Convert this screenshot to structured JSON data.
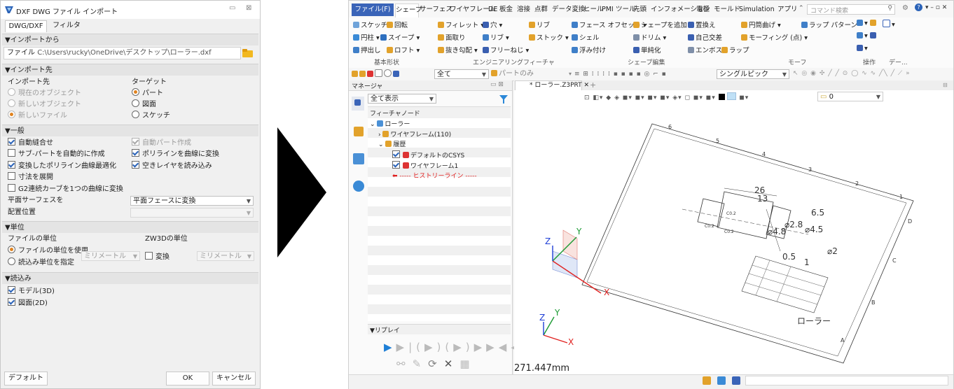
{
  "dialog": {
    "title": "DXF DWG ファイル インポート",
    "tabs": [
      "DWG/DXF",
      "フィルタ"
    ],
    "import_from": {
      "header": "▼インポートから",
      "file_label": "ファイル",
      "file_value": "C:\\Users\\rucky\\OneDrive\\デスクトップ\\ローラー.dxf"
    },
    "import_to": {
      "header": "▼インポート先",
      "dest_label": "インポート先",
      "dest_options": [
        "現在のオブジェクト",
        "新しいオブジェクト",
        "新しいファイル"
      ],
      "target_label": "ターゲット",
      "target_options": [
        "パート",
        "図面",
        "スケッチ"
      ]
    },
    "general": {
      "header": "▼一般",
      "left": [
        "自動縫合せ",
        "サブ-パートを自動的に作成",
        "変換したポリライン曲線最適化",
        "寸法を展開",
        "G2連続カーブを1つの曲線に変換"
      ],
      "right": [
        "自動パート作成",
        "ポリラインを曲線に変換",
        "空きレイヤを読み込み"
      ],
      "plane_face_label": "平面サーフェスを",
      "plane_face_value": "平面フェースに変換",
      "placement_label": "配置位置"
    },
    "units": {
      "header": "▼単位",
      "file_units_label": "ファイルの単位",
      "use_file_units": "ファイルの単位を使用",
      "specify_units": "読込み単位を指定",
      "unit_value": "ミリメートル",
      "zw3d_units_label": "ZW3Dの単位",
      "convert_label": "変換",
      "zw3d_unit_value": "ミリメートル"
    },
    "read": {
      "header": "▼読込み",
      "items": [
        "モデル(3D)",
        "図面(2D)"
      ]
    },
    "buttons": {
      "default": "デフォルト",
      "ok": "OK",
      "cancel": "キャンセル"
    }
  },
  "app": {
    "menu": [
      "ファイル(F)",
      "シェープ",
      "サーフェス",
      "ワイヤフレーム",
      "DE",
      "板金",
      "溶接",
      "点群",
      "データ変換",
      "ヒール",
      "PMI",
      "ツール",
      "先頭",
      "インフォメーション",
      "電極",
      "モールド",
      "Simulation",
      "アプリ"
    ],
    "command_search_placeholder": "コマンド検索",
    "ribbon": {
      "basic_shape": {
        "label": "基本形状",
        "items": [
          "スケッチ",
          "回転",
          "円柱",
          "スイープ",
          "押出し",
          "ロフト"
        ]
      },
      "engineering": {
        "label": "エンジニアリングフィーチャ",
        "items": [
          "フィレット",
          "穴",
          "リブ",
          "面取り",
          "リブ",
          "ストック",
          "抜き勾配",
          "フリーねじ"
        ]
      },
      "shape_edit": {
        "label": "シェープ編集",
        "items": [
          "フェース オフセット",
          "シェープを追加",
          "置換え",
          "シェル",
          "ドリム",
          "自己交差",
          "浮み付け",
          "単純化",
          "エンボス",
          "ラップ"
        ]
      },
      "morph": {
        "label": "モーフ",
        "items": [
          "円筒曲げ",
          "ラップ パターン",
          "モーフィング (点)"
        ]
      },
      "ops": {
        "label": "操作"
      },
      "data": {
        "label": "デー..."
      }
    },
    "toolbar": {
      "filter_all": "全て",
      "part_only": "パートのみ",
      "pick_mode": "シングルピック"
    },
    "manager": {
      "title": "マネージャ",
      "show_all": "全て表示",
      "feature_node_header": "フィーチャノード",
      "tree": [
        "ローラー",
        "ワイヤフレーム(110)",
        "履歴",
        "デフォルトのCSYS",
        "ワイヤフレーム1",
        "----- ヒストリーライン -----"
      ]
    },
    "replay": {
      "header": "▼リプレイ"
    },
    "doc_tab": "* ローラー.Z3PRT",
    "view_field_value": "0",
    "measure": "271.447mm",
    "drawing": {
      "dims": [
        "26",
        "13",
        "⌀4.8",
        "6.5",
        "⌀2.8",
        "⌀4.5",
        "0.5",
        "1",
        "⌀2"
      ],
      "title_block_name": "ローラー",
      "frame_numbers": [
        "6",
        "5",
        "4",
        "3",
        "2",
        "1"
      ],
      "frame_letters": [
        "D",
        "C",
        "B",
        "A"
      ],
      "chamfer_labels": [
        "C0.2",
        "C0.2",
        "C0.2"
      ]
    },
    "axes": {
      "x": "X",
      "y": "Y",
      "z": "Z"
    }
  },
  "colors": {
    "accent": "#2b63b8",
    "file_menu": "#3a64b8",
    "radio_active": "#e0831f",
    "axis_x": "#e0211f",
    "axis_y": "#1a9a32",
    "axis_z": "#1f3fd6",
    "history_line": "#e02020"
  }
}
